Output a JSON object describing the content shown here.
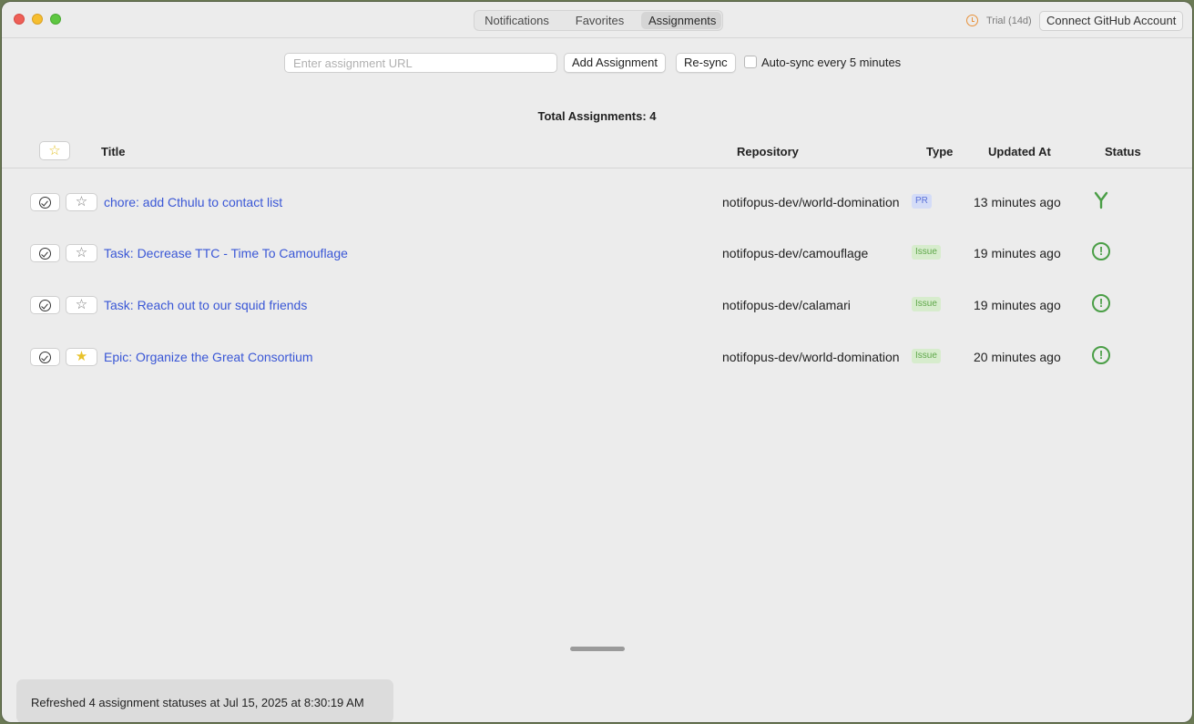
{
  "tabs": [
    {
      "label": "Notifications",
      "active": false
    },
    {
      "label": "Favorites",
      "active": false
    },
    {
      "label": "Assignments",
      "active": true
    }
  ],
  "header": {
    "trial_label": "Trial (14d)",
    "connect_label": "Connect GitHub Account"
  },
  "toolbar": {
    "url_placeholder": "Enter assignment URL",
    "url_value": "",
    "add_label": "Add Assignment",
    "resync_label": "Re-sync",
    "autosync_label": "Auto-sync every 5 minutes",
    "autosync_checked": false
  },
  "summary": {
    "total_label": "Total Assignments: 4"
  },
  "table": {
    "headers": {
      "favorite": "☆",
      "title": "Title",
      "repository": "Repository",
      "type": "Type",
      "updated": "Updated At",
      "status": "Status"
    },
    "rows": [
      {
        "title": "chore: add Cthulu to contact list",
        "repo": "notifopus-dev/world-domination",
        "type": "PR",
        "updated": "13 minutes ago",
        "status_icon": "merged-pr-icon",
        "starred": false
      },
      {
        "title": "Task: Decrease TTC - Time To Camouflage",
        "repo": "notifopus-dev/camouflage",
        "type": "Issue",
        "updated": "19 minutes ago",
        "status_icon": "open-issue-icon",
        "starred": false
      },
      {
        "title": "Task: Reach out to our squid friends",
        "repo": "notifopus-dev/calamari",
        "type": "Issue",
        "updated": "19 minutes ago",
        "status_icon": "open-issue-icon",
        "starred": false
      },
      {
        "title": "Epic: Organize the Great Consortium",
        "repo": "notifopus-dev/world-domination",
        "type": "Issue",
        "updated": "20 minutes ago",
        "status_icon": "open-issue-icon",
        "starred": true
      }
    ],
    "star_off": "☆",
    "star_on": "★",
    "issue_glyph": "!"
  },
  "status_bar": {
    "message": "Refreshed 4 assignment statuses at Jul 15, 2025 at 8:30:19 AM"
  },
  "colors": {
    "link": "#3a57d6",
    "status_green": "#4a9e46",
    "star_yellow": "#e8c22a",
    "trial_orange": "#e8913a"
  }
}
